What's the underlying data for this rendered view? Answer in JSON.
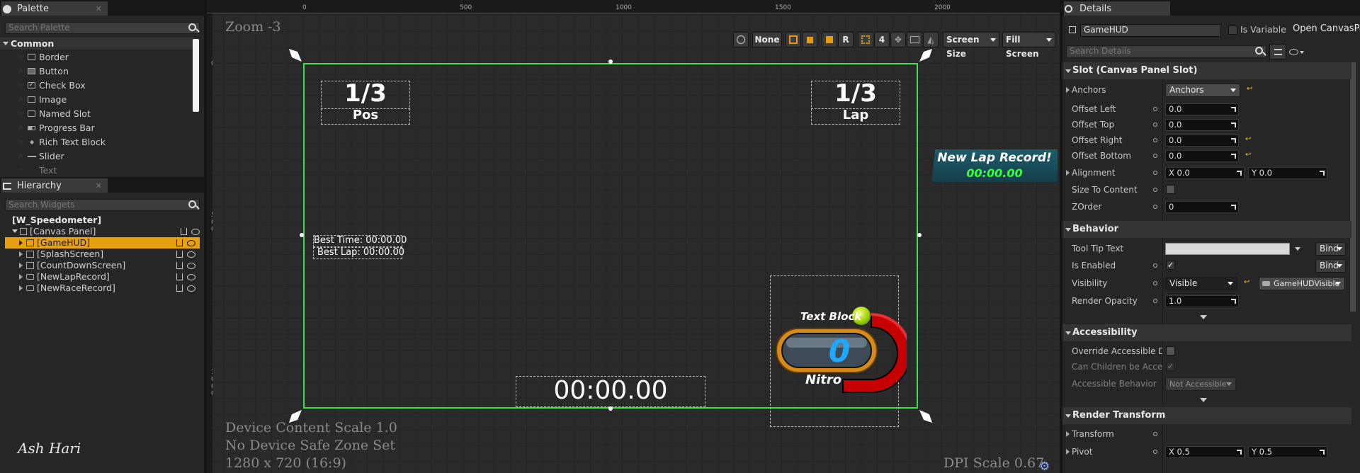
{
  "palette": {
    "tab": "Palette",
    "search_placeholder": "Search Palette",
    "category": "Common",
    "items": [
      "Border",
      "Button",
      "Check Box",
      "Image",
      "Named Slot",
      "Progress Bar",
      "Rich Text Block",
      "Slider",
      "Text"
    ]
  },
  "hierarchy": {
    "tab": "Hierarchy",
    "search_placeholder": "Search Widgets",
    "root": "[W_Speedometer]",
    "canvas": "[Canvas Panel]",
    "items": [
      "[GameHUD]",
      "[SplashScreen]",
      "[CountDownScreen]",
      "[NewLapRecord]",
      "[NewRaceRecord]"
    ]
  },
  "viewport": {
    "zoom": "Zoom -3",
    "ruler_top": [
      "0",
      "500",
      "1000",
      "1500",
      "2000"
    ],
    "ruler_left": [
      "0",
      "500",
      "1000"
    ],
    "toolbar": {
      "none": "None",
      "r": "R",
      "grid_num": "4",
      "screen_size": "Screen Size",
      "fill_screen": "Fill Screen"
    },
    "device_scale": "Device Content Scale 1.0",
    "safe_zone": "No Device Safe Zone Set",
    "resolution": "1280 x 720 (16:9)",
    "dpi_scale": "DPI Scale 0.67",
    "author": "Ash Hari"
  },
  "hud": {
    "pos_value": "1/3",
    "pos_label": "Pos",
    "lap_value": "1/3",
    "lap_label": "Lap",
    "best_time": "Best Time: 00:00.00",
    "best_lap": "Best Lap: 00:00.00",
    "timer": "00:00.00",
    "speed": "0",
    "text_block": "Text Block",
    "nitro": "Nitro",
    "new_lap_title": "New Lap Record!",
    "new_lap_time": "00:00.00",
    "colors": {
      "selection": "#3ee04a",
      "record_green": "#3bff3b",
      "speed_blue": "#1fa8ff",
      "gauge_red": "#cc0000"
    }
  },
  "details": {
    "tab": "Details",
    "name": "GameHUD",
    "is_variable": "Is Variable",
    "open_canvas": "Open CanvasPa",
    "search_placeholder": "Search Details",
    "slot_section": "Slot (Canvas Panel Slot)",
    "anchors_label": "Anchors",
    "anchors_value": "Anchors",
    "offset_left": {
      "label": "Offset Left",
      "value": "0.0"
    },
    "offset_top": {
      "label": "Offset Top",
      "value": "0.0"
    },
    "offset_right": {
      "label": "Offset Right",
      "value": "0.0"
    },
    "offset_bottom": {
      "label": "Offset Bottom",
      "value": "0.0"
    },
    "alignment": {
      "label": "Alignment",
      "x": "X 0.0",
      "y": "Y 0.0"
    },
    "size_to_content": "Size To Content",
    "zorder": {
      "label": "ZOrder",
      "value": "0"
    },
    "behavior_section": "Behavior",
    "tooltip": "Tool Tip Text",
    "bind": "Bind",
    "is_enabled": "Is Enabled",
    "visibility": {
      "label": "Visibility",
      "value": "Visible",
      "binding": "GameHUDVisible"
    },
    "render_opacity": {
      "label": "Render Opacity",
      "value": "1.0"
    },
    "accessibility_section": "Accessibility",
    "override_accessible": "Override Accessible Defa",
    "can_children": "Can Children be Accessit",
    "accessible_behavior": {
      "label": "Accessible Behavior",
      "value": "Not Accessible"
    },
    "render_transform_section": "Render Transform",
    "transform": "Transform",
    "pivot": {
      "label": "Pivot",
      "x": "X 0.5",
      "y": "Y 0.5"
    }
  }
}
